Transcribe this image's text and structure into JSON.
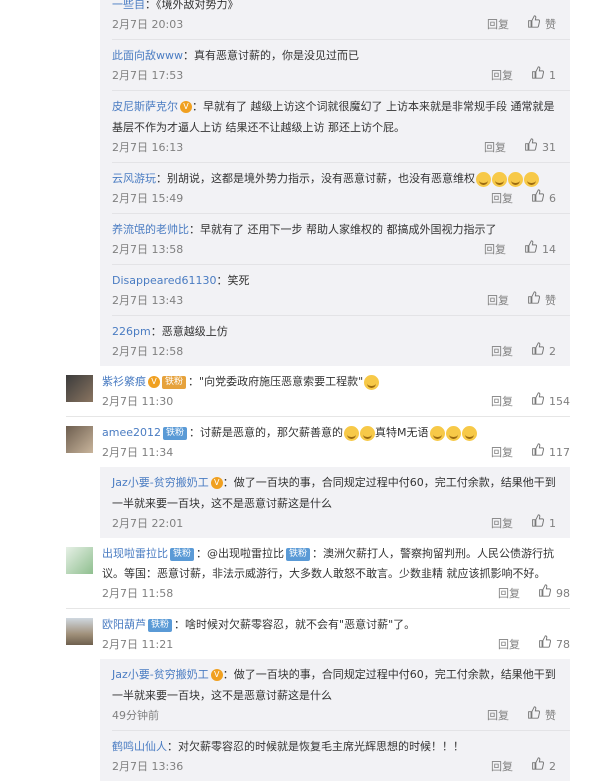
{
  "labels": {
    "reply": "回复",
    "like": "赞"
  },
  "block1": [
    {
      "name": "一些自",
      "text": "：《境外敌对势力》",
      "time": "2月7日 20:03",
      "likes": "赞"
    },
    {
      "name": "此面向敌www",
      "text": "：真有恶意讨薪的，你是没见过而已",
      "time": "2月7日 17:53",
      "likes": "1"
    },
    {
      "name": "皮尼斯萨克尔",
      "text": "：早就有了 越级上访这个词就很魔幻了 上访本来就是非常规手段 通常就是基层不作为才逼人上访 结果还不让越级上访 那还上访个屁。",
      "time": "2月7日 16:13",
      "likes": "31"
    },
    {
      "name": "云风游玩",
      "text": "：别胡说，这都是境外势力指示，没有恶意讨薪，也没有恶意维权",
      "time": "2月7日 15:49",
      "likes": "6"
    },
    {
      "name": "养流氓的老帅比",
      "text": "：早就有了 还用下一步 帮助人家维权的 都搞成外国视力指示了",
      "time": "2月7日 13:58",
      "likes": "14"
    },
    {
      "name": "Disappeared61130",
      "text": "：笑死",
      "time": "2月7日 13:43",
      "likes": "赞"
    },
    {
      "name": "226pm",
      "text": "：恶意越级上仿",
      "time": "2月7日 12:58",
      "likes": "2"
    }
  ],
  "c1": {
    "name": "紫衫綮痕",
    "badge": "铁粉",
    "text": "：\"向党委政府施压恶意索要工程款\"",
    "time": "2月7日 11:30",
    "likes": "154"
  },
  "c2": {
    "name": "amee2012",
    "badge": "铁粉",
    "text": "：讨薪是恶意的，那欠薪善意的",
    "text2": "真特M无语",
    "time": "2月7日 11:34",
    "likes": "117"
  },
  "block2": [
    {
      "name": "Jaz小要-贫穷搬奶工",
      "text": "：做了一百块的事，合同规定过程中付60，完工付余款，结果他干到一半就来要一百块，这不是恶意讨薪这是什么",
      "time": "2月7日 22:01",
      "likes": "1"
    }
  ],
  "c3": {
    "name": "出现啦雷拉比",
    "badge": "铁粉",
    "text": "：@出现啦雷拉比",
    "badge2": "铁粉",
    "text2": "：澳洲欠薪打人，警察拘留判刑。人民公债游行抗议。等国：恶意讨薪，非法示威游行，大多数人敢怒不敢言。少数韭精 就应该抓影响不好。",
    "time": "2月7日 11:58",
    "likes": "98"
  },
  "c4": {
    "name": "欧阳葫芦",
    "badge": "铁粉",
    "text": "：啥时候对欠薪零容忍，就不会有\"恶意讨薪\"了。",
    "time": "2月7日 11:21",
    "likes": "78"
  },
  "block3": [
    {
      "name": "Jaz小要-贫穷搬奶工",
      "text": "：做了一百块的事，合同规定过程中付60，完工付余款，结果他干到一半就来要一百块，这不是恶意讨薪这是什么",
      "time": "49分钟前",
      "likes": "赞"
    },
    {
      "name": "鹤鸣山仙人",
      "text": "：对欠薪零容忍的时候就是恢复毛主席光辉思想的时候！！！",
      "time": "2月7日 13:36",
      "likes": "2"
    }
  ]
}
